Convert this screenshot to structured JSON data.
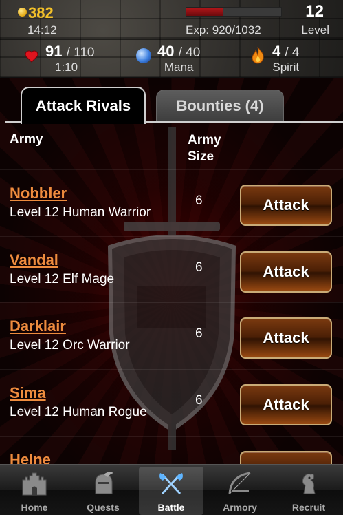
{
  "status": {
    "gold": "382",
    "gold_timer": "14:12",
    "exp_text": "Exp: 920/1032",
    "exp_progress": 0.39,
    "level": "12",
    "level_label": "Level",
    "health": {
      "value": "91",
      "max": "/ 110",
      "sub": "1:10"
    },
    "mana": {
      "value": "40",
      "max": "/ 40",
      "sub": "Mana"
    },
    "spirit": {
      "value": "4",
      "max": "/ 4",
      "sub": "Spirit"
    }
  },
  "tabs": [
    {
      "label": "Attack Rivals"
    },
    {
      "label": "Bounties (4)"
    }
  ],
  "columns": {
    "army": "Army",
    "size_line1": "Army",
    "size_line2": "Size"
  },
  "rivals": [
    {
      "name": "Nobbler",
      "desc": "Level 12 Human Warrior",
      "size": "6",
      "action": "Attack"
    },
    {
      "name": "Vandal",
      "desc": "Level 12 Elf Mage",
      "size": "6",
      "action": "Attack"
    },
    {
      "name": "Darklair",
      "desc": "Level 12 Orc Warrior",
      "size": "6",
      "action": "Attack"
    },
    {
      "name": "Sima",
      "desc": "Level 12 Human Rogue",
      "size": "6",
      "action": "Attack"
    },
    {
      "name": "Helne",
      "desc": "",
      "size": "",
      "action": ""
    }
  ],
  "tabbar": [
    {
      "label": "Home",
      "icon": "castle-icon"
    },
    {
      "label": "Quests",
      "icon": "knight-helmet-icon"
    },
    {
      "label": "Battle",
      "icon": "crossed-axes-icon"
    },
    {
      "label": "Armory",
      "icon": "bow-icon"
    },
    {
      "label": "Recruit",
      "icon": "griffin-crest-icon"
    }
  ],
  "colors": {
    "gold": "#f2c029",
    "rival_name": "#ee8c3e",
    "xp_fill": "#b3161a",
    "button_border": "#c9ab77"
  }
}
